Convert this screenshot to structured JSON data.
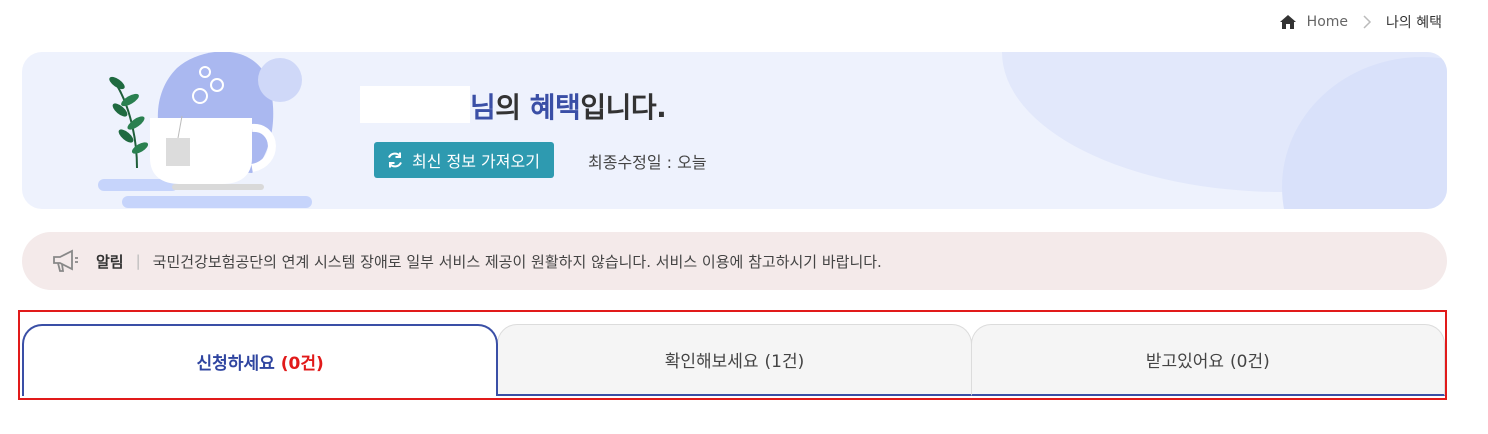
{
  "breadcrumb": {
    "home_label": "Home",
    "current_label": "나의 혜택",
    "icons": {
      "home": "home-icon",
      "separator": "chevron-right-icon"
    }
  },
  "hero": {
    "greeting_suffix": "님",
    "greeting_mid": "의 ",
    "greeting_bold": "혜택",
    "greeting_end": "입니다.",
    "refresh_button_label": "최신 정보 가져오기",
    "refresh_icon": "refresh-icon",
    "last_modified_label": "최종수정일 : 오늘"
  },
  "notice": {
    "icon": "megaphone-icon",
    "label": "알림",
    "separator": "|",
    "message": "국민건강보험공단의 연계 시스템 장애로 일부 서비스 제공이 원활하지 않습니다. 서비스 이용에 참고하시기 바랍니다."
  },
  "tabs": [
    {
      "label": "신청하세요",
      "count": "(0건)",
      "active": true
    },
    {
      "label": "확인해보세요",
      "count": "(1건)",
      "active": false
    },
    {
      "label": "받고있어요",
      "count": "(0건)",
      "active": false
    }
  ],
  "colors": {
    "accent": "#3a4fa6",
    "button": "#2e9ab0",
    "alert": "#e11a1a",
    "hero_bg": "#eef2fd",
    "notice_bg": "#f4eaea"
  }
}
